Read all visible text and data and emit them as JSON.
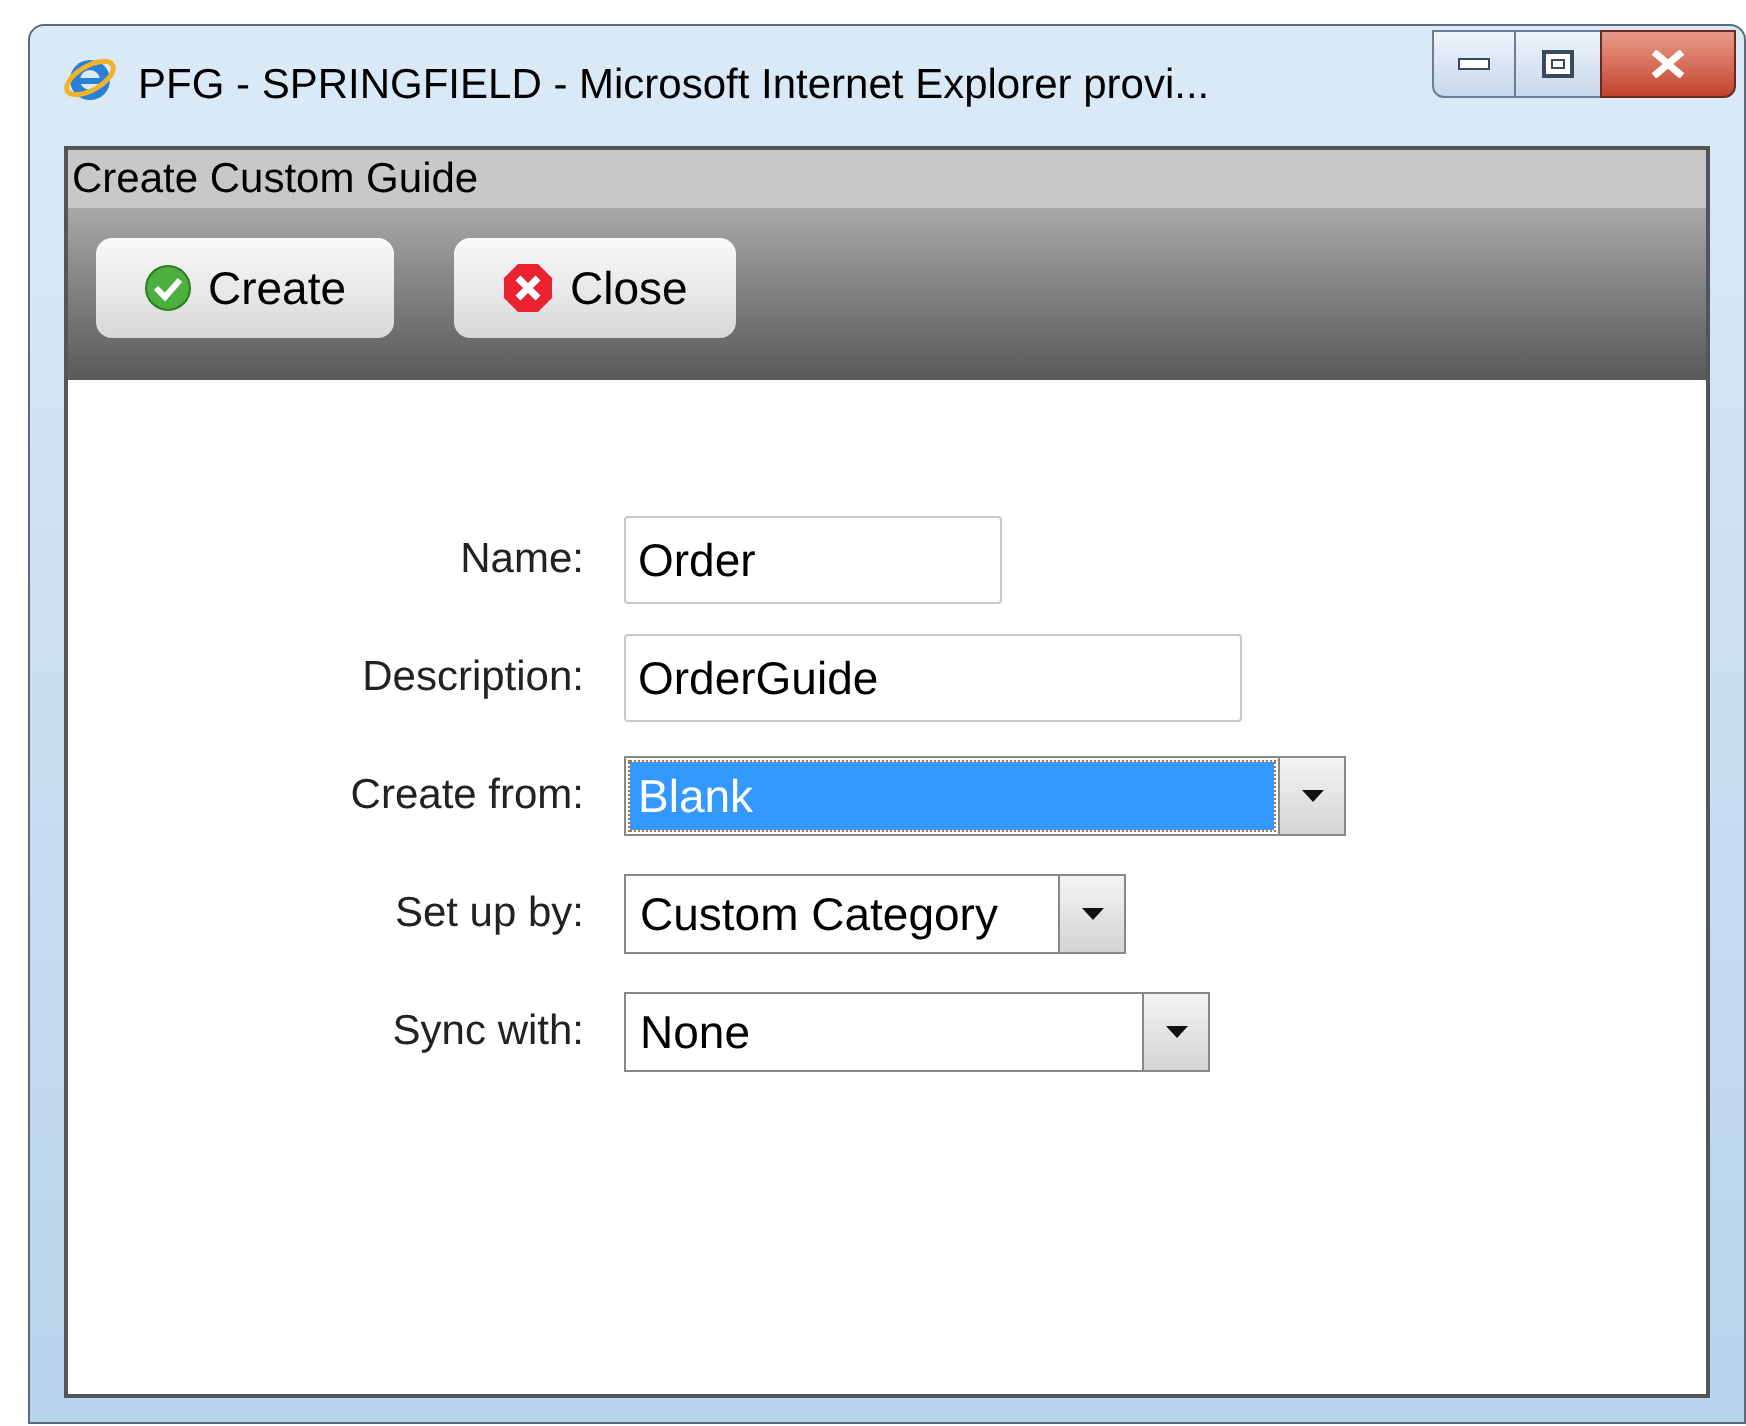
{
  "window": {
    "title": "PFG - SPRINGFIELD - Microsoft Internet Explorer provi..."
  },
  "dialog": {
    "title": "Create Custom Guide"
  },
  "toolbar": {
    "buttons": [
      {
        "label": "Create",
        "kind": "create"
      },
      {
        "label": "Close",
        "kind": "close"
      }
    ]
  },
  "form": {
    "fields": [
      {
        "label": "Name:",
        "kind": "text",
        "value": "Order"
      },
      {
        "label": "Description:",
        "kind": "text",
        "value": "OrderGuide"
      },
      {
        "label": "Create from:",
        "kind": "select",
        "value": "Blank",
        "focused": true
      },
      {
        "label": "Set up by:",
        "kind": "select",
        "value": "Custom Category",
        "focused": false
      },
      {
        "label": "Sync with:",
        "kind": "select",
        "value": "None",
        "focused": false
      }
    ]
  }
}
